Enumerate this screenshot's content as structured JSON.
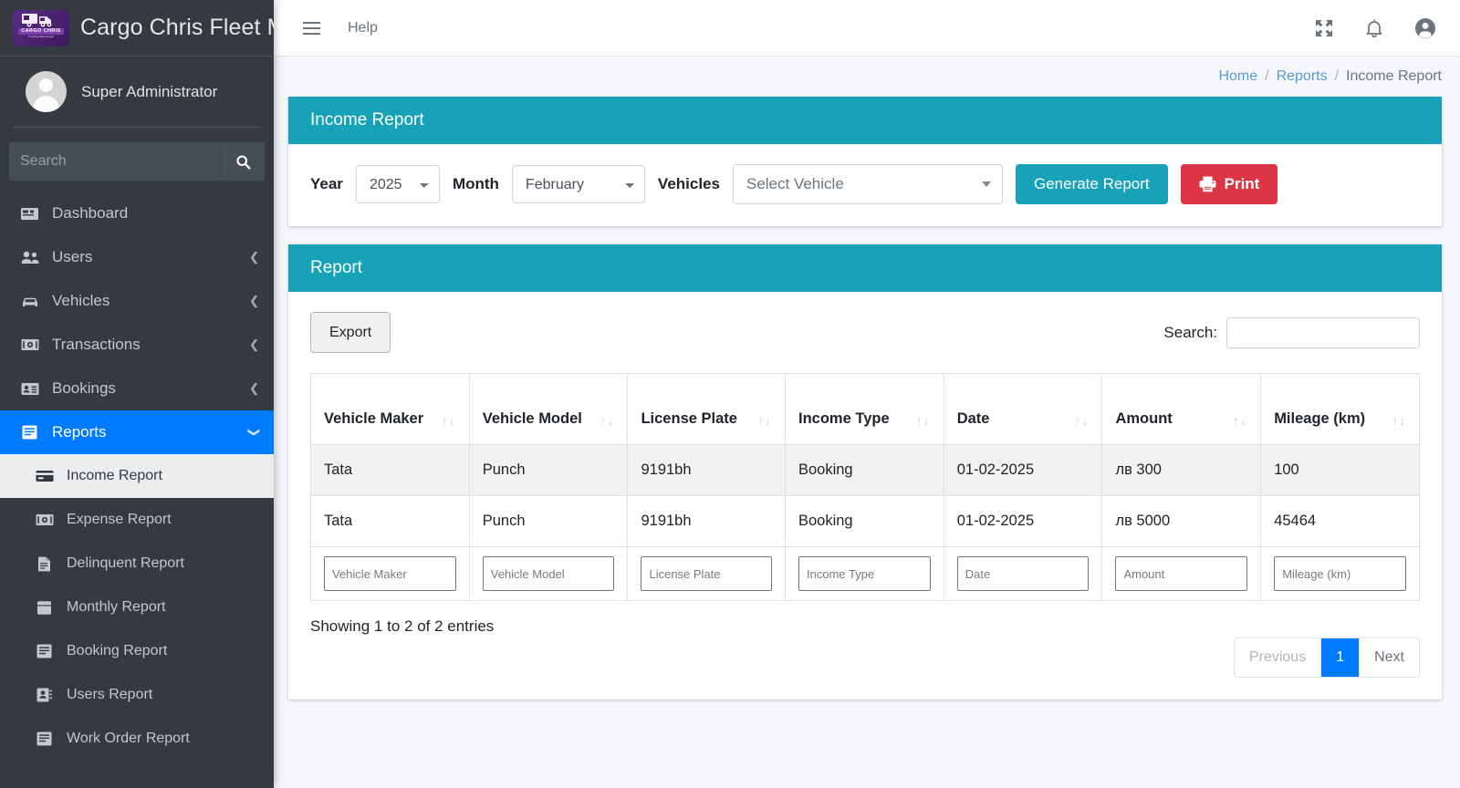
{
  "sidebar": {
    "brand_title": "Cargo Chris Fleet Man",
    "logo_word": "CARGO CHRIS",
    "logo_sub": "Trucking Wild Design",
    "user_name": "Super Administrator",
    "search_placeholder": "Search",
    "items": [
      {
        "label": "Dashboard",
        "icon": "dashboard-icon",
        "chevron": "",
        "state": "normal"
      },
      {
        "label": "Users",
        "icon": "users-icon",
        "chevron": "❮",
        "state": "normal"
      },
      {
        "label": "Vehicles",
        "icon": "car-icon",
        "chevron": "❮",
        "state": "normal"
      },
      {
        "label": "Transactions",
        "icon": "money-icon",
        "chevron": "❮",
        "state": "normal"
      },
      {
        "label": "Bookings",
        "icon": "id-card-icon",
        "chevron": "❮",
        "state": "normal"
      },
      {
        "label": "Reports",
        "icon": "book-icon",
        "chevron": "❯",
        "state": "active"
      },
      {
        "label": "Income Report",
        "icon": "card-icon",
        "chevron": "",
        "state": "current-sub"
      },
      {
        "label": "Expense Report",
        "icon": "money-icon",
        "chevron": "",
        "state": "sub"
      },
      {
        "label": "Delinquent Report",
        "icon": "file-icon",
        "chevron": "",
        "state": "sub"
      },
      {
        "label": "Monthly Report",
        "icon": "calendar-icon",
        "chevron": "",
        "state": "sub"
      },
      {
        "label": "Booking Report",
        "icon": "book-icon",
        "chevron": "",
        "state": "sub"
      },
      {
        "label": "Users Report",
        "icon": "contact-book-icon",
        "chevron": "",
        "state": "sub"
      },
      {
        "label": "Work Order Report",
        "icon": "book-icon",
        "chevron": "",
        "state": "sub"
      }
    ]
  },
  "topbar": {
    "help_label": "Help",
    "icons": [
      "fullscreen-icon",
      "bell-icon",
      "user-circle-icon"
    ]
  },
  "breadcrumb": {
    "home": "Home",
    "sep": "/",
    "reports": "Reports",
    "current": "Income Report"
  },
  "filter_card": {
    "title": "Income Report",
    "year_label": "Year",
    "year_value": "2025",
    "month_label": "Month",
    "month_value": "February",
    "vehicles_label": "Vehicles",
    "vehicle_value": "Select Vehicle",
    "generate_label": "Generate Report",
    "print_label": "Print"
  },
  "report_card": {
    "title": "Report",
    "export_label": "Export",
    "search_label": "Search:",
    "search_value": "",
    "search_placeholder": "",
    "columns": [
      "Vehicle Maker",
      "Vehicle Model",
      "License Plate",
      "Income Type",
      "Date",
      "Amount",
      "Mileage (km)"
    ],
    "sort_icon": "↑↓",
    "rows": [
      [
        "Tata",
        "Punch",
        "9191bh",
        "Booking",
        "01-02-2025",
        "лв 300",
        "100"
      ],
      [
        "Tata",
        "Punch",
        "9191bh",
        "Booking",
        "01-02-2025",
        "лв 5000",
        "45464"
      ]
    ],
    "filter_placeholders": [
      "Vehicle Maker",
      "Vehicle Model",
      "License Plate",
      "Income Type",
      "Date",
      "Amount",
      "Mileage (km)"
    ],
    "info": "Showing 1 to 2 of 2 entries",
    "pagination": {
      "previous": "Previous",
      "page": "1",
      "next": "Next"
    }
  },
  "colors": {
    "sidebar_bg": "#343a40",
    "accent_blue": "#007bff",
    "card_header_teal": "#17a2b8",
    "print_red": "#dc3545",
    "logo_purple": "#5b2a86"
  }
}
